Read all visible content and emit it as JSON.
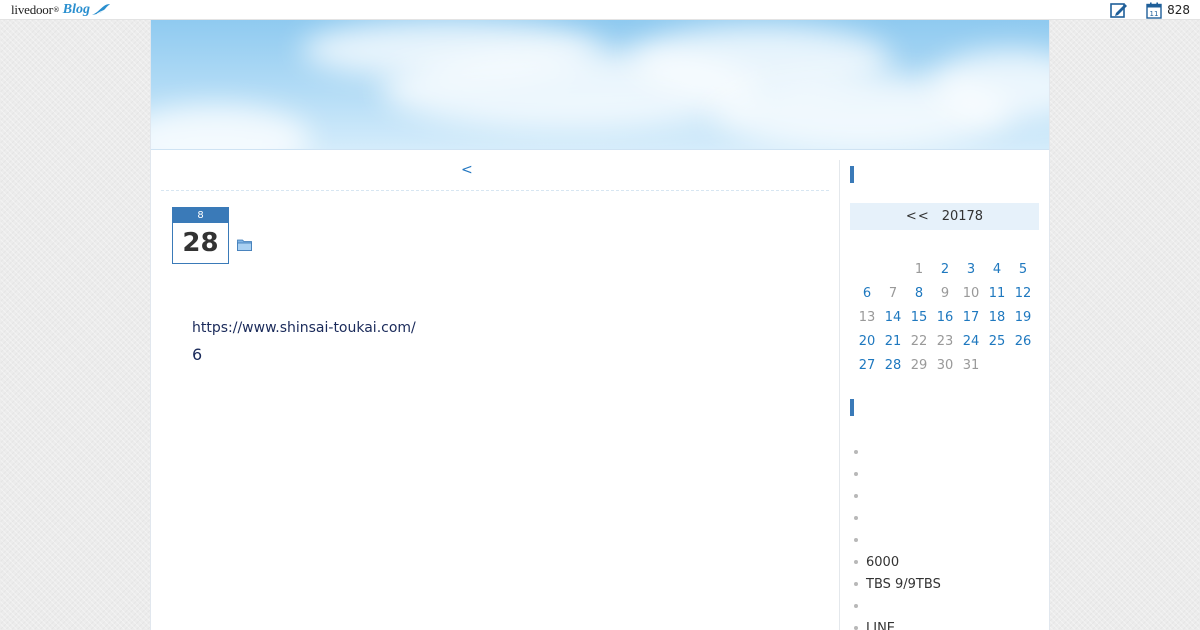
{
  "topbar": {
    "logo_text": "livedoor",
    "logo_mark": "®",
    "logo_blog": "Blog",
    "calendar_count": "828",
    "icons": [
      "edit-icon",
      "calendar-icon"
    ]
  },
  "nav": {
    "prev_label": "<"
  },
  "article": {
    "month": "8",
    "day": "28",
    "category_icon": "folder-icon",
    "link_text": "https://www.shinsai-toukai.com/",
    "body_text": "6"
  },
  "calendar": {
    "prev_label": "<<",
    "month_label": "20178",
    "rows": [
      [
        {
          "d": ""
        },
        {
          "d": ""
        },
        {
          "d": "1"
        },
        {
          "d": "2",
          "link": true
        },
        {
          "d": "3",
          "link": true
        },
        {
          "d": "4",
          "link": true
        },
        {
          "d": "5",
          "link": true
        }
      ],
      [
        {
          "d": "6",
          "link": true
        },
        {
          "d": "7"
        },
        {
          "d": "8",
          "link": true
        },
        {
          "d": "9"
        },
        {
          "d": "10"
        },
        {
          "d": "11",
          "link": true
        },
        {
          "d": "12",
          "link": true
        }
      ],
      [
        {
          "d": "13"
        },
        {
          "d": "14",
          "link": true
        },
        {
          "d": "15",
          "link": true
        },
        {
          "d": "16",
          "link": true
        },
        {
          "d": "17",
          "link": true
        },
        {
          "d": "18",
          "link": true
        },
        {
          "d": "19",
          "link": true
        }
      ],
      [
        {
          "d": "20",
          "link": true
        },
        {
          "d": "21",
          "link": true
        },
        {
          "d": "22"
        },
        {
          "d": "23"
        },
        {
          "d": "24",
          "link": true
        },
        {
          "d": "25",
          "link": true
        },
        {
          "d": "26",
          "link": true
        }
      ],
      [
        {
          "d": "27",
          "link": true
        },
        {
          "d": "28",
          "link": true
        },
        {
          "d": "29"
        },
        {
          "d": "30"
        },
        {
          "d": "31"
        },
        {
          "d": ""
        },
        {
          "d": ""
        }
      ]
    ]
  },
  "recent_entries": [
    "",
    "",
    "",
    "",
    "",
    "6000",
    "TBS 9/9TBS",
    "",
    "LINE",
    ""
  ],
  "colors": {
    "accent": "#3a7ab8",
    "link": "#1e78bf",
    "calendar_header_bg": "#e6f1fa"
  }
}
